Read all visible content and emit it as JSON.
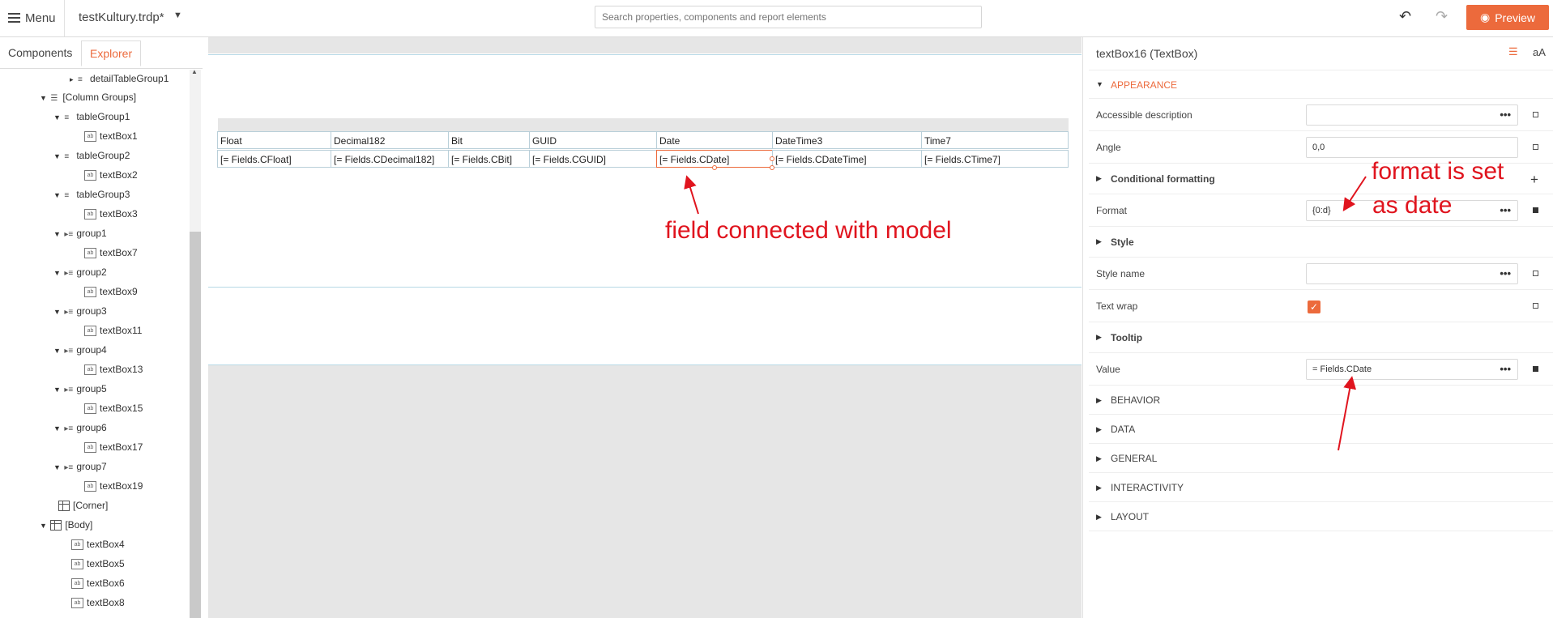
{
  "topbar": {
    "menu_label": "Menu",
    "file_name": "testKultury.trdp*",
    "search_placeholder": "Search properties, components and report elements",
    "preview_label": "Preview"
  },
  "left_panel": {
    "tabs": [
      "Components",
      "Explorer"
    ],
    "active_tab": "Explorer",
    "tree": [
      "detailTableGroup1",
      "[Column Groups]",
      "tableGroup1",
      "textBox1",
      "tableGroup2",
      "textBox2",
      "tableGroup3",
      "textBox3",
      "group1",
      "textBox7",
      "group2",
      "textBox9",
      "group3",
      "textBox11",
      "group4",
      "textBox13",
      "group5",
      "textBox15",
      "group6",
      "textBox17",
      "group7",
      "textBox19",
      "[Corner]",
      "[Body]",
      "textBox4",
      "textBox5",
      "textBox6",
      "textBox8"
    ]
  },
  "canvas": {
    "headers": [
      "Float",
      "Decimal182",
      "Bit",
      "GUID",
      "Date",
      "DateTime3",
      "Time7"
    ],
    "values": [
      "[= Fields.CFloat]",
      "[= Fields.CDecimal182]",
      "[= Fields.CBit]",
      "[= Fields.CGUID]",
      "[= Fields.CDate]",
      "[= Fields.CDateTime]",
      "[= Fields.CTime7]"
    ],
    "annotation_field": "field connected with model",
    "annotation_format_line1": "format is set",
    "annotation_format_line2": "as date"
  },
  "right_panel": {
    "title": "textBox16 (TextBox)",
    "aa": "aA",
    "appearance": "APPEARANCE",
    "props": {
      "accessible_description": {
        "label": "Accessible description",
        "value": ""
      },
      "angle": {
        "label": "Angle",
        "value": "0,0"
      },
      "conditional_formatting": "Conditional formatting",
      "format": {
        "label": "Format",
        "value": "{0:d}"
      },
      "style": "Style",
      "style_name": {
        "label": "Style name",
        "value": ""
      },
      "text_wrap": {
        "label": "Text wrap",
        "checked": true
      },
      "tooltip": "Tooltip",
      "value": {
        "label": "Value",
        "value": "= Fields.CDate"
      }
    },
    "sections": [
      "BEHAVIOR",
      "DATA",
      "GENERAL",
      "INTERACTIVITY",
      "LAYOUT"
    ],
    "dots": "•••"
  },
  "colors": {
    "accent": "#ec6a3c",
    "annotation": "#e0141e"
  }
}
